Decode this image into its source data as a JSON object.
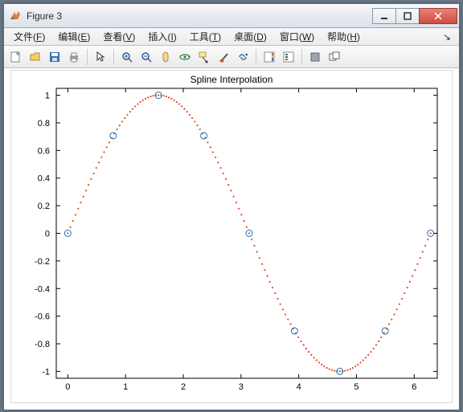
{
  "window": {
    "title": "Figure 3"
  },
  "menu": {
    "file": {
      "label": "文件",
      "accel": "F"
    },
    "edit": {
      "label": "编辑",
      "accel": "E"
    },
    "view": {
      "label": "查看",
      "accel": "V"
    },
    "insert": {
      "label": "插入",
      "accel": "I"
    },
    "tools": {
      "label": "工具",
      "accel": "T"
    },
    "desktop": {
      "label": "桌面",
      "accel": "D"
    },
    "window": {
      "label": "窗口",
      "accel": "W"
    },
    "help": {
      "label": "帮助",
      "accel": "H"
    }
  },
  "toolbar": {
    "new": "new-figure-icon",
    "open": "open-file-icon",
    "save": "save-icon",
    "print": "print-icon",
    "arrow": "edit-arrow-icon",
    "zoomin": "zoom-in-icon",
    "zoomout": "zoom-out-icon",
    "pan": "pan-icon",
    "rotate": "rotate3d-icon",
    "datatips": "data-cursor-icon",
    "brush": "brush-icon",
    "link": "link-plots-icon",
    "colorbar": "colorbar-icon",
    "legend": "legend-icon",
    "hideplot": "hide-plot-icon",
    "showplot": "show-plot-icon"
  },
  "chart_data": {
    "type": "line",
    "title": "Spline Interpolation",
    "xlabel": "",
    "ylabel": "",
    "xlim": [
      -0.2,
      6.4
    ],
    "ylim": [
      -1.05,
      1.05
    ],
    "xticks": [
      0,
      1,
      2,
      3,
      4,
      5,
      6
    ],
    "yticks": [
      -1,
      -0.8,
      -0.6,
      -0.4,
      -0.2,
      0,
      0.2,
      0.4,
      0.6,
      0.8,
      1
    ],
    "series": [
      {
        "name": "spline-curve",
        "style": "dotted",
        "color": "#d9502a",
        "values": "sin(x) for x in 0..6.2832"
      },
      {
        "name": "knot-points",
        "style": "markers",
        "marker": "circle-open",
        "color": "#1f6fb3",
        "x": [
          0,
          0.7854,
          1.5708,
          2.3562,
          3.1416,
          3.927,
          4.7124,
          5.4978,
          6.2832
        ],
        "y": [
          0,
          0.7071,
          1.0,
          0.7071,
          0,
          -0.7071,
          -1.0,
          -0.7071,
          0
        ]
      }
    ]
  }
}
